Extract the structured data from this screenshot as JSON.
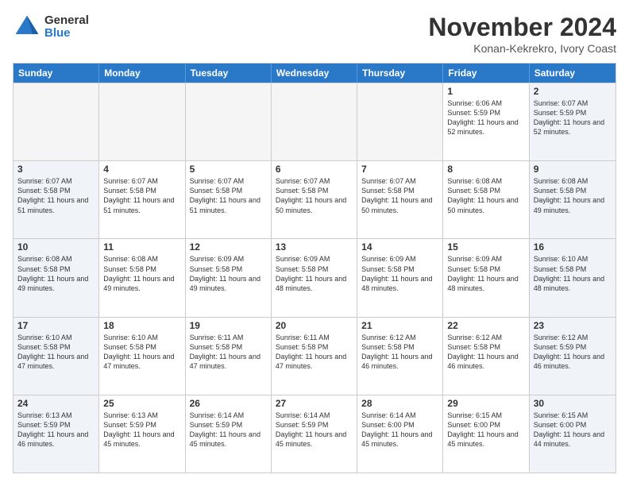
{
  "logo": {
    "general": "General",
    "blue": "Blue"
  },
  "title": "November 2024",
  "location": "Konan-Kekrekro, Ivory Coast",
  "header_days": [
    "Sunday",
    "Monday",
    "Tuesday",
    "Wednesday",
    "Thursday",
    "Friday",
    "Saturday"
  ],
  "weeks": [
    [
      {
        "day": "",
        "empty": true
      },
      {
        "day": "",
        "empty": true
      },
      {
        "day": "",
        "empty": true
      },
      {
        "day": "",
        "empty": true
      },
      {
        "day": "",
        "empty": true
      },
      {
        "day": "1",
        "info": "Sunrise: 6:06 AM\nSunset: 5:59 PM\nDaylight: 11 hours\nand 52 minutes."
      },
      {
        "day": "2",
        "info": "Sunrise: 6:07 AM\nSunset: 5:59 PM\nDaylight: 11 hours\nand 52 minutes."
      }
    ],
    [
      {
        "day": "3",
        "info": "Sunrise: 6:07 AM\nSunset: 5:58 PM\nDaylight: 11 hours\nand 51 minutes."
      },
      {
        "day": "4",
        "info": "Sunrise: 6:07 AM\nSunset: 5:58 PM\nDaylight: 11 hours\nand 51 minutes."
      },
      {
        "day": "5",
        "info": "Sunrise: 6:07 AM\nSunset: 5:58 PM\nDaylight: 11 hours\nand 51 minutes."
      },
      {
        "day": "6",
        "info": "Sunrise: 6:07 AM\nSunset: 5:58 PM\nDaylight: 11 hours\nand 50 minutes."
      },
      {
        "day": "7",
        "info": "Sunrise: 6:07 AM\nSunset: 5:58 PM\nDaylight: 11 hours\nand 50 minutes."
      },
      {
        "day": "8",
        "info": "Sunrise: 6:08 AM\nSunset: 5:58 PM\nDaylight: 11 hours\nand 50 minutes."
      },
      {
        "day": "9",
        "info": "Sunrise: 6:08 AM\nSunset: 5:58 PM\nDaylight: 11 hours\nand 49 minutes."
      }
    ],
    [
      {
        "day": "10",
        "info": "Sunrise: 6:08 AM\nSunset: 5:58 PM\nDaylight: 11 hours\nand 49 minutes."
      },
      {
        "day": "11",
        "info": "Sunrise: 6:08 AM\nSunset: 5:58 PM\nDaylight: 11 hours\nand 49 minutes."
      },
      {
        "day": "12",
        "info": "Sunrise: 6:09 AM\nSunset: 5:58 PM\nDaylight: 11 hours\nand 49 minutes."
      },
      {
        "day": "13",
        "info": "Sunrise: 6:09 AM\nSunset: 5:58 PM\nDaylight: 11 hours\nand 48 minutes."
      },
      {
        "day": "14",
        "info": "Sunrise: 6:09 AM\nSunset: 5:58 PM\nDaylight: 11 hours\nand 48 minutes."
      },
      {
        "day": "15",
        "info": "Sunrise: 6:09 AM\nSunset: 5:58 PM\nDaylight: 11 hours\nand 48 minutes."
      },
      {
        "day": "16",
        "info": "Sunrise: 6:10 AM\nSunset: 5:58 PM\nDaylight: 11 hours\nand 48 minutes."
      }
    ],
    [
      {
        "day": "17",
        "info": "Sunrise: 6:10 AM\nSunset: 5:58 PM\nDaylight: 11 hours\nand 47 minutes."
      },
      {
        "day": "18",
        "info": "Sunrise: 6:10 AM\nSunset: 5:58 PM\nDaylight: 11 hours\nand 47 minutes."
      },
      {
        "day": "19",
        "info": "Sunrise: 6:11 AM\nSunset: 5:58 PM\nDaylight: 11 hours\nand 47 minutes."
      },
      {
        "day": "20",
        "info": "Sunrise: 6:11 AM\nSunset: 5:58 PM\nDaylight: 11 hours\nand 47 minutes."
      },
      {
        "day": "21",
        "info": "Sunrise: 6:12 AM\nSunset: 5:58 PM\nDaylight: 11 hours\nand 46 minutes."
      },
      {
        "day": "22",
        "info": "Sunrise: 6:12 AM\nSunset: 5:58 PM\nDaylight: 11 hours\nand 46 minutes."
      },
      {
        "day": "23",
        "info": "Sunrise: 6:12 AM\nSunset: 5:59 PM\nDaylight: 11 hours\nand 46 minutes."
      }
    ],
    [
      {
        "day": "24",
        "info": "Sunrise: 6:13 AM\nSunset: 5:59 PM\nDaylight: 11 hours\nand 46 minutes."
      },
      {
        "day": "25",
        "info": "Sunrise: 6:13 AM\nSunset: 5:59 PM\nDaylight: 11 hours\nand 45 minutes."
      },
      {
        "day": "26",
        "info": "Sunrise: 6:14 AM\nSunset: 5:59 PM\nDaylight: 11 hours\nand 45 minutes."
      },
      {
        "day": "27",
        "info": "Sunrise: 6:14 AM\nSunset: 5:59 PM\nDaylight: 11 hours\nand 45 minutes."
      },
      {
        "day": "28",
        "info": "Sunrise: 6:14 AM\nSunset: 6:00 PM\nDaylight: 11 hours\nand 45 minutes."
      },
      {
        "day": "29",
        "info": "Sunrise: 6:15 AM\nSunset: 6:00 PM\nDaylight: 11 hours\nand 45 minutes."
      },
      {
        "day": "30",
        "info": "Sunrise: 6:15 AM\nSunset: 6:00 PM\nDaylight: 11 hours\nand 44 minutes."
      }
    ]
  ]
}
